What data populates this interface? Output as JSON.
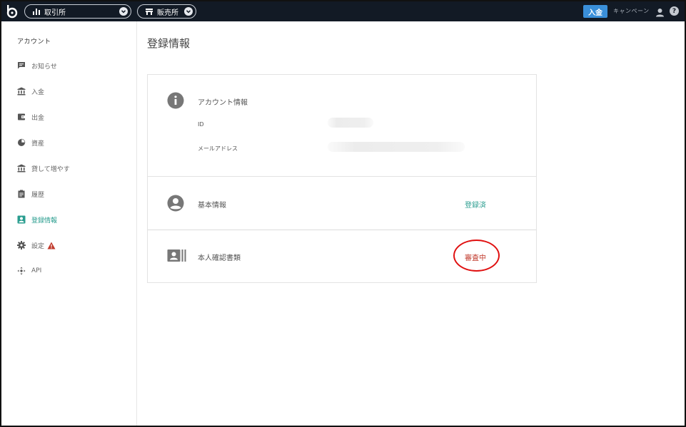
{
  "topbar": {
    "exchange_label": "取引所",
    "shop_label": "販売所",
    "deposit_label": "入金",
    "campaign_label": "キャンペーン",
    "help_label": "?"
  },
  "sidebar": {
    "title": "アカウント",
    "items": [
      {
        "label": "お知らせ",
        "icon": "message-icon"
      },
      {
        "label": "入金",
        "icon": "bank-icon"
      },
      {
        "label": "出金",
        "icon": "wallet-icon"
      },
      {
        "label": "資産",
        "icon": "pie-chart-icon"
      },
      {
        "label": "貸して増やす",
        "icon": "bank-icon"
      },
      {
        "label": "履歴",
        "icon": "clipboard-icon"
      },
      {
        "label": "登録情報",
        "icon": "account-box-icon",
        "active": true
      },
      {
        "label": "設定",
        "icon": "gear-icon",
        "warning": true
      },
      {
        "label": "API",
        "icon": "api-icon"
      }
    ]
  },
  "main": {
    "title": "登録情報",
    "account_info": {
      "label": "アカウント情報",
      "id_label": "ID",
      "email_label": "メールアドレス"
    },
    "basic_info": {
      "label": "基本情報",
      "status": "登録済"
    },
    "identity_docs": {
      "label": "本人確認書類",
      "status": "審査中"
    }
  },
  "colors": {
    "topbar_bg": "#121a25",
    "accent_teal": "#2a9d8f",
    "deposit_blue": "#3a8fd9",
    "review_red": "#c0392b",
    "annotation_red": "#e01010"
  }
}
